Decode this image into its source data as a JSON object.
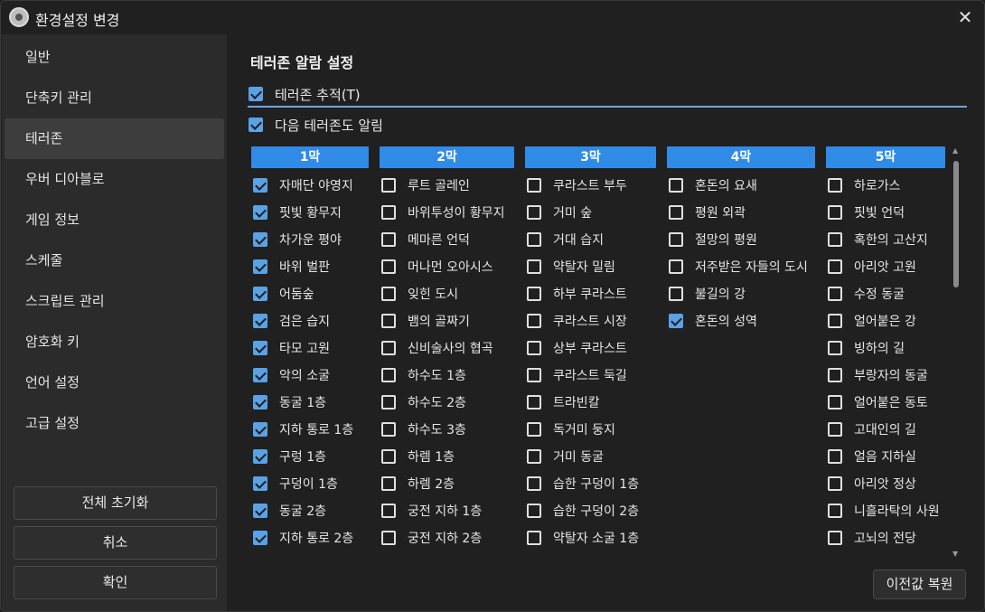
{
  "window": {
    "title": "환경설정 변경"
  },
  "sidebar": {
    "items": [
      {
        "label": "일반",
        "active": false
      },
      {
        "label": "단축키 관리",
        "active": false
      },
      {
        "label": "테러존",
        "active": true
      },
      {
        "label": "우버 디아블로",
        "active": false
      },
      {
        "label": "게임 정보",
        "active": false
      },
      {
        "label": "스케줄",
        "active": false
      },
      {
        "label": "스크립트 관리",
        "active": false
      },
      {
        "label": "암호화 키",
        "active": false
      },
      {
        "label": "언어 설정",
        "active": false
      },
      {
        "label": "고급 설정",
        "active": false
      }
    ],
    "buttons": {
      "reset_all": "전체 초기화",
      "cancel": "취소",
      "confirm": "확인"
    }
  },
  "main": {
    "section_title": "테러존 알람 설정",
    "track_checkbox": {
      "label": "테러존 추적(T)",
      "checked": true
    },
    "next_alert_checkbox": {
      "label": "다음 테러존도 알림",
      "checked": true
    },
    "restore_button": "이전값 복원",
    "accent_color": "#2f8be6",
    "acts": [
      {
        "label": "1막",
        "zones": [
          {
            "label": "자매단 야영지",
            "checked": true
          },
          {
            "label": "핏빛 황무지",
            "checked": true
          },
          {
            "label": "차가운 평야",
            "checked": true
          },
          {
            "label": "바위 벌판",
            "checked": true
          },
          {
            "label": "어둠숲",
            "checked": true
          },
          {
            "label": "검은 습지",
            "checked": true
          },
          {
            "label": "타모 고원",
            "checked": true
          },
          {
            "label": "악의 소굴",
            "checked": true
          },
          {
            "label": "동굴 1층",
            "checked": true
          },
          {
            "label": "지하 통로 1층",
            "checked": true
          },
          {
            "label": "구렁 1층",
            "checked": true
          },
          {
            "label": "구덩이 1층",
            "checked": true
          },
          {
            "label": "동굴 2층",
            "checked": true
          },
          {
            "label": "지하 통로 2층",
            "checked": true
          }
        ]
      },
      {
        "label": "2막",
        "zones": [
          {
            "label": "루트 골레인",
            "checked": false
          },
          {
            "label": "바위투성이 황무지",
            "checked": false
          },
          {
            "label": "메마른 언덕",
            "checked": false
          },
          {
            "label": "머나먼 오아시스",
            "checked": false
          },
          {
            "label": "잊힌 도시",
            "checked": false
          },
          {
            "label": "뱀의 골짜기",
            "checked": false
          },
          {
            "label": "신비술사의 협곡",
            "checked": false
          },
          {
            "label": "하수도 1층",
            "checked": false
          },
          {
            "label": "하수도 2층",
            "checked": false
          },
          {
            "label": "하수도 3층",
            "checked": false
          },
          {
            "label": "하렘 1층",
            "checked": false
          },
          {
            "label": "하렘 2층",
            "checked": false
          },
          {
            "label": "궁전 지하 1층",
            "checked": false
          },
          {
            "label": "궁전 지하 2층",
            "checked": false
          }
        ]
      },
      {
        "label": "3막",
        "zones": [
          {
            "label": "쿠라스트 부두",
            "checked": false
          },
          {
            "label": "거미 숲",
            "checked": false
          },
          {
            "label": "거대 습지",
            "checked": false
          },
          {
            "label": "약탈자 밀림",
            "checked": false
          },
          {
            "label": "하부 쿠라스트",
            "checked": false
          },
          {
            "label": "쿠라스트 시장",
            "checked": false
          },
          {
            "label": "상부 쿠라스트",
            "checked": false
          },
          {
            "label": "쿠라스트 둑길",
            "checked": false
          },
          {
            "label": "트라빈칼",
            "checked": false
          },
          {
            "label": "독거미 둥지",
            "checked": false
          },
          {
            "label": "거미 동굴",
            "checked": false
          },
          {
            "label": "습한 구덩이 1층",
            "checked": false
          },
          {
            "label": "습한 구덩이 2층",
            "checked": false
          },
          {
            "label": "약탈자 소굴 1층",
            "checked": false
          }
        ]
      },
      {
        "label": "4막",
        "zones": [
          {
            "label": "혼돈의 요새",
            "checked": false
          },
          {
            "label": "평원 외곽",
            "checked": false
          },
          {
            "label": "절망의 평원",
            "checked": false
          },
          {
            "label": "저주받은 자들의 도시",
            "checked": false
          },
          {
            "label": "불길의 강",
            "checked": false
          },
          {
            "label": "혼돈의 성역",
            "checked": true
          }
        ]
      },
      {
        "label": "5막",
        "zones": [
          {
            "label": "하로가스",
            "checked": false
          },
          {
            "label": "핏빛 언덕",
            "checked": false
          },
          {
            "label": "혹한의 고산지",
            "checked": false
          },
          {
            "label": "아리앗 고원",
            "checked": false
          },
          {
            "label": "수정 동굴",
            "checked": false
          },
          {
            "label": "얼어붙은 강",
            "checked": false
          },
          {
            "label": "빙하의 길",
            "checked": false
          },
          {
            "label": "부랑자의 동굴",
            "checked": false
          },
          {
            "label": "얼어붙은 동토",
            "checked": false
          },
          {
            "label": "고대인의 길",
            "checked": false
          },
          {
            "label": "얼음 지하실",
            "checked": false
          },
          {
            "label": "아리앗 정상",
            "checked": false
          },
          {
            "label": "니흘라탁의 사원",
            "checked": false
          },
          {
            "label": "고뇌의 전당",
            "checked": false
          }
        ]
      }
    ]
  }
}
